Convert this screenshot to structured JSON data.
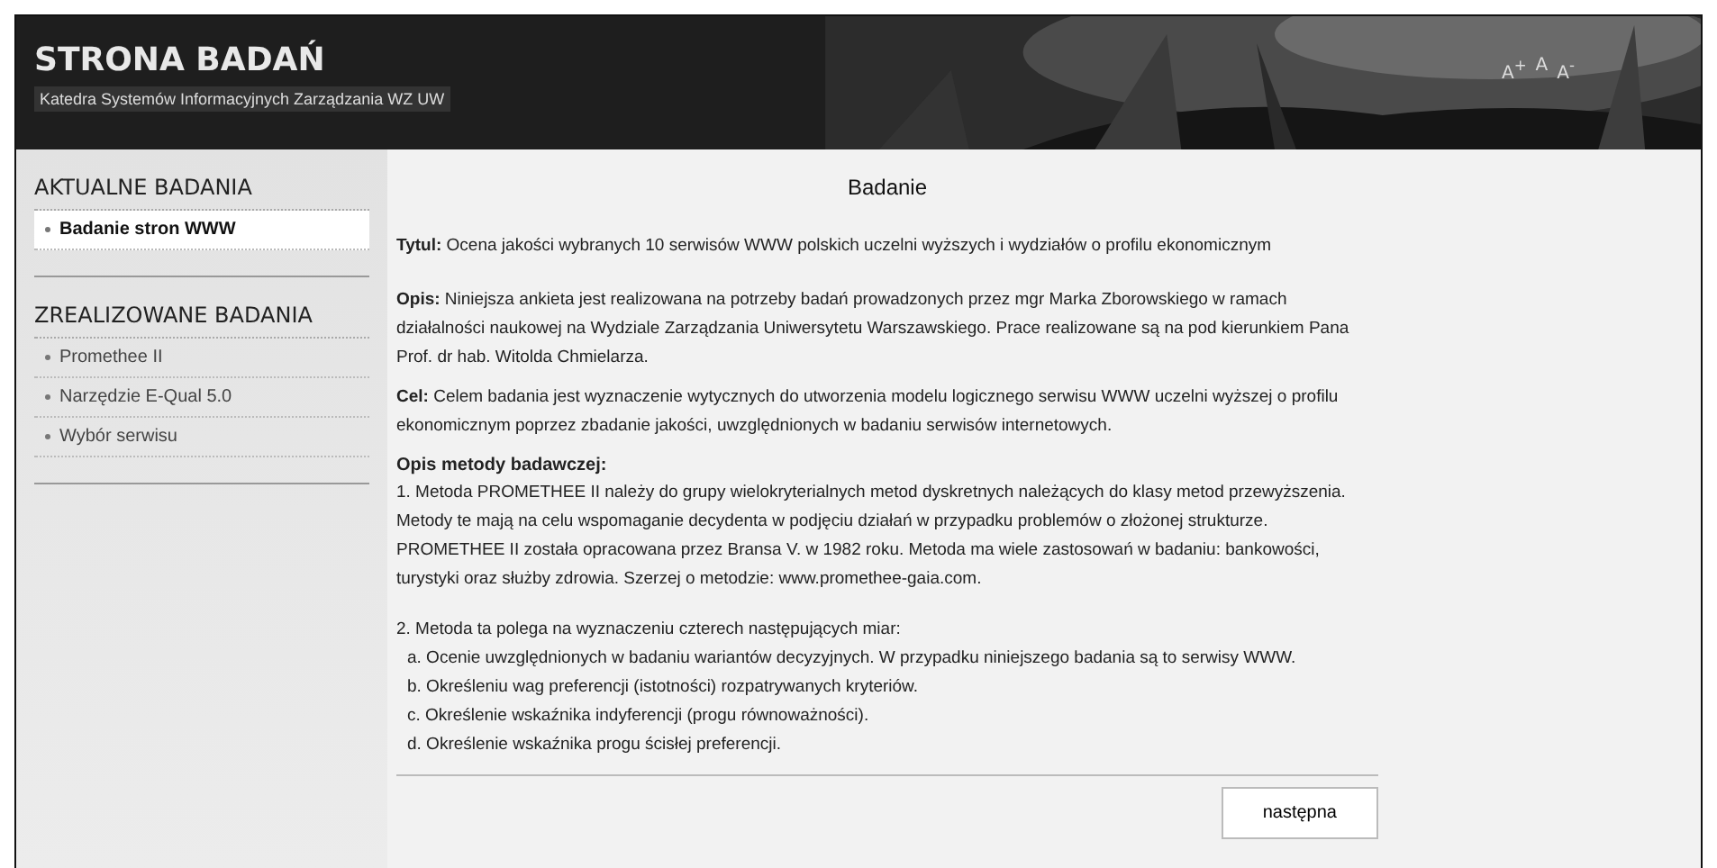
{
  "header": {
    "title": "STRONA BADAŃ",
    "subtitle": "Katedra Systemów Informacyjnych Zarządzania WZ UW",
    "font_controls": [
      "A$^{+}$",
      "A",
      "A$^{-}$"
    ]
  },
  "sidebar": {
    "sections": [
      {
        "heading": "AKTUALNE BADANIA",
        "items": [
          {
            "label": "Badanie stron WWW",
            "selected": true
          }
        ]
      },
      {
        "heading": "ZREALIZOWANE BADANIA",
        "items": [
          {
            "label": "Promethee II",
            "selected": false
          },
          {
            "label": "Narzędzie E-Qual 5.0",
            "selected": false
          },
          {
            "label": "Wybór serwisu",
            "selected": false
          }
        ]
      }
    ]
  },
  "main": {
    "title": "Badanie",
    "paragraphs": [
      "**Tytul:** Ocena jakości wybranych 10 serwisów WWW polskich uczelni wyższych i wydziałów o profilu ekonomicznym",
      "**Opis:** Niniejsza ankieta jest realizowana na potrzeby badań prowadzonych przez mgr Marka Zborowskiego w ramach działalności naukowej na Wydziale Zarządzania Uniwersytetu Warszawskiego. Prace realizowane są na pod kierunkiem Pana Prof. dr hab. Witolda Chmielarza.",
      "**Cel:** Celem badania jest wyznaczenie wytycznych do utworzenia modelu logicznego serwisu WWW uczelni wyższej o profilu ekonomicznym poprzez zbadanie jakości, uwzględnionych w badaniu serwisów internetowych."
    ],
    "method": {
      "heading": "Opis metody badawczej:",
      "point_1": "1. Metoda PROMETHEE II należy do grupy wielokryterialnych metod dyskretnych należących do klasy metod przewyższenia. Metody te mają na celu wspomaganie decydenta w podjęciu działań w przypadku problemów o złożonej strukturze. PROMETHEE II została opracowana przez Bransa V. w 1982 roku. Metoda ma wiele zastosowań w badaniu: bankowości, turystyki oraz służby zdrowia. Szerzej o metodzie: www.promethee-gaia.com.",
      "point_2": "2. Metoda ta polega na wyznaczeniu czterech następujących miar:",
      "sub_items": [
        "a. Ocenie uwzględnionych w badaniu wariantów decyzyjnych. W przypadku niniejszego badania są to serwisy WWW.",
        "b. Określeniu wag preferencji (istotności) rozpatrywanych kryteriów.",
        "c. Określenie wskaźnika indyferencji (progu równoważności).",
        "d. Określenie wskaźnika progu ścisłej preferencji."
      ]
    },
    "button": "następna"
  }
}
